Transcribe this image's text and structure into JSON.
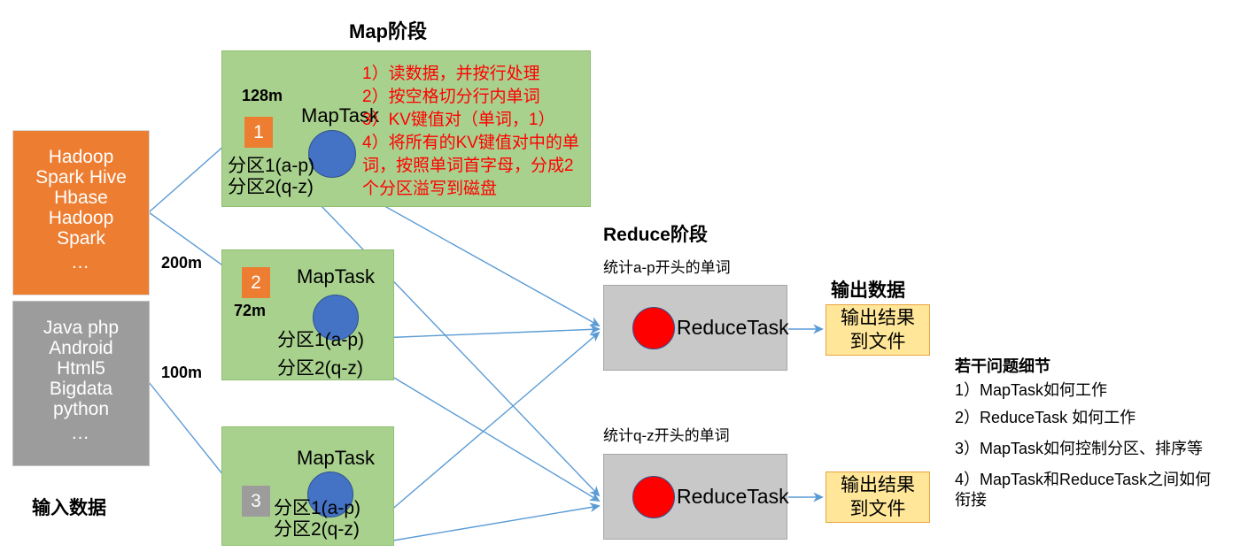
{
  "titles": {
    "map_phase": "Map阶段",
    "reduce_phase": "Reduce阶段",
    "input_data": "输入数据",
    "output_data": "输出数据",
    "questions_title": "若干问题细节"
  },
  "input_blocks": [
    {
      "id": "orange",
      "lines": [
        "Hadoop",
        "Spark Hive",
        "Hbase",
        "Hadoop",
        "Spark"
      ],
      "ellipsis": "…",
      "size_label": "200m",
      "color": "#ED7D31"
    },
    {
      "id": "gray",
      "lines": [
        "Java php",
        "Android",
        "Html5",
        "Bigdata",
        "python"
      ],
      "ellipsis": "…",
      "size_label": "100m",
      "color": "#9C9C9C"
    }
  ],
  "map_blocks": [
    {
      "chunk_number": "1",
      "chunk_color": "#ED7D31",
      "size_label": "128m",
      "task_label": "MapTask",
      "partitions": [
        "分区1(a-p)",
        "分区2(q-z)"
      ]
    },
    {
      "chunk_number": "2",
      "chunk_color": "#ED7D31",
      "size_label": "72m",
      "task_label": "MapTask",
      "partitions": [
        "分区1(a-p)",
        "分区2(q-z)"
      ]
    },
    {
      "chunk_number": "3",
      "chunk_color": "#9C9C9C",
      "size_label": "",
      "task_label": "MapTask",
      "partitions": [
        "分区1(a-p)",
        "分区2(q-z)"
      ]
    }
  ],
  "map_notes": [
    "1）读数据，并按行处理",
    "2）按空格切分行内单词",
    "3）KV键值对（单词，1）",
    "4）将所有的KV键值对中的单词，按照单词首字母，分成2个分区溢写到磁盘"
  ],
  "reduce_blocks": [
    {
      "caption": "统计a-p开头的单词",
      "task_label": "ReduceTask",
      "output_lines": [
        "输出结果",
        "到文件"
      ]
    },
    {
      "caption": "统计q-z开头的单词",
      "task_label": "ReduceTask",
      "output_lines": [
        "输出结果",
        "到文件"
      ]
    }
  ],
  "questions": [
    "1）MapTask如何工作",
    "2）ReduceTask 如何工作",
    "3）MapTask如何控制分区、排序等",
    "4）MapTask和ReduceTask之间如何衔接"
  ],
  "colors": {
    "map_block_bg": "#A9D18E",
    "blue_circle": "#4472C4",
    "red_circle": "#FF0000",
    "reduce_block_bg": "#C8C8C8",
    "output_box_bg": "#FFE699",
    "arrow": "#5B9BD5",
    "note_text": "#FF0000"
  }
}
